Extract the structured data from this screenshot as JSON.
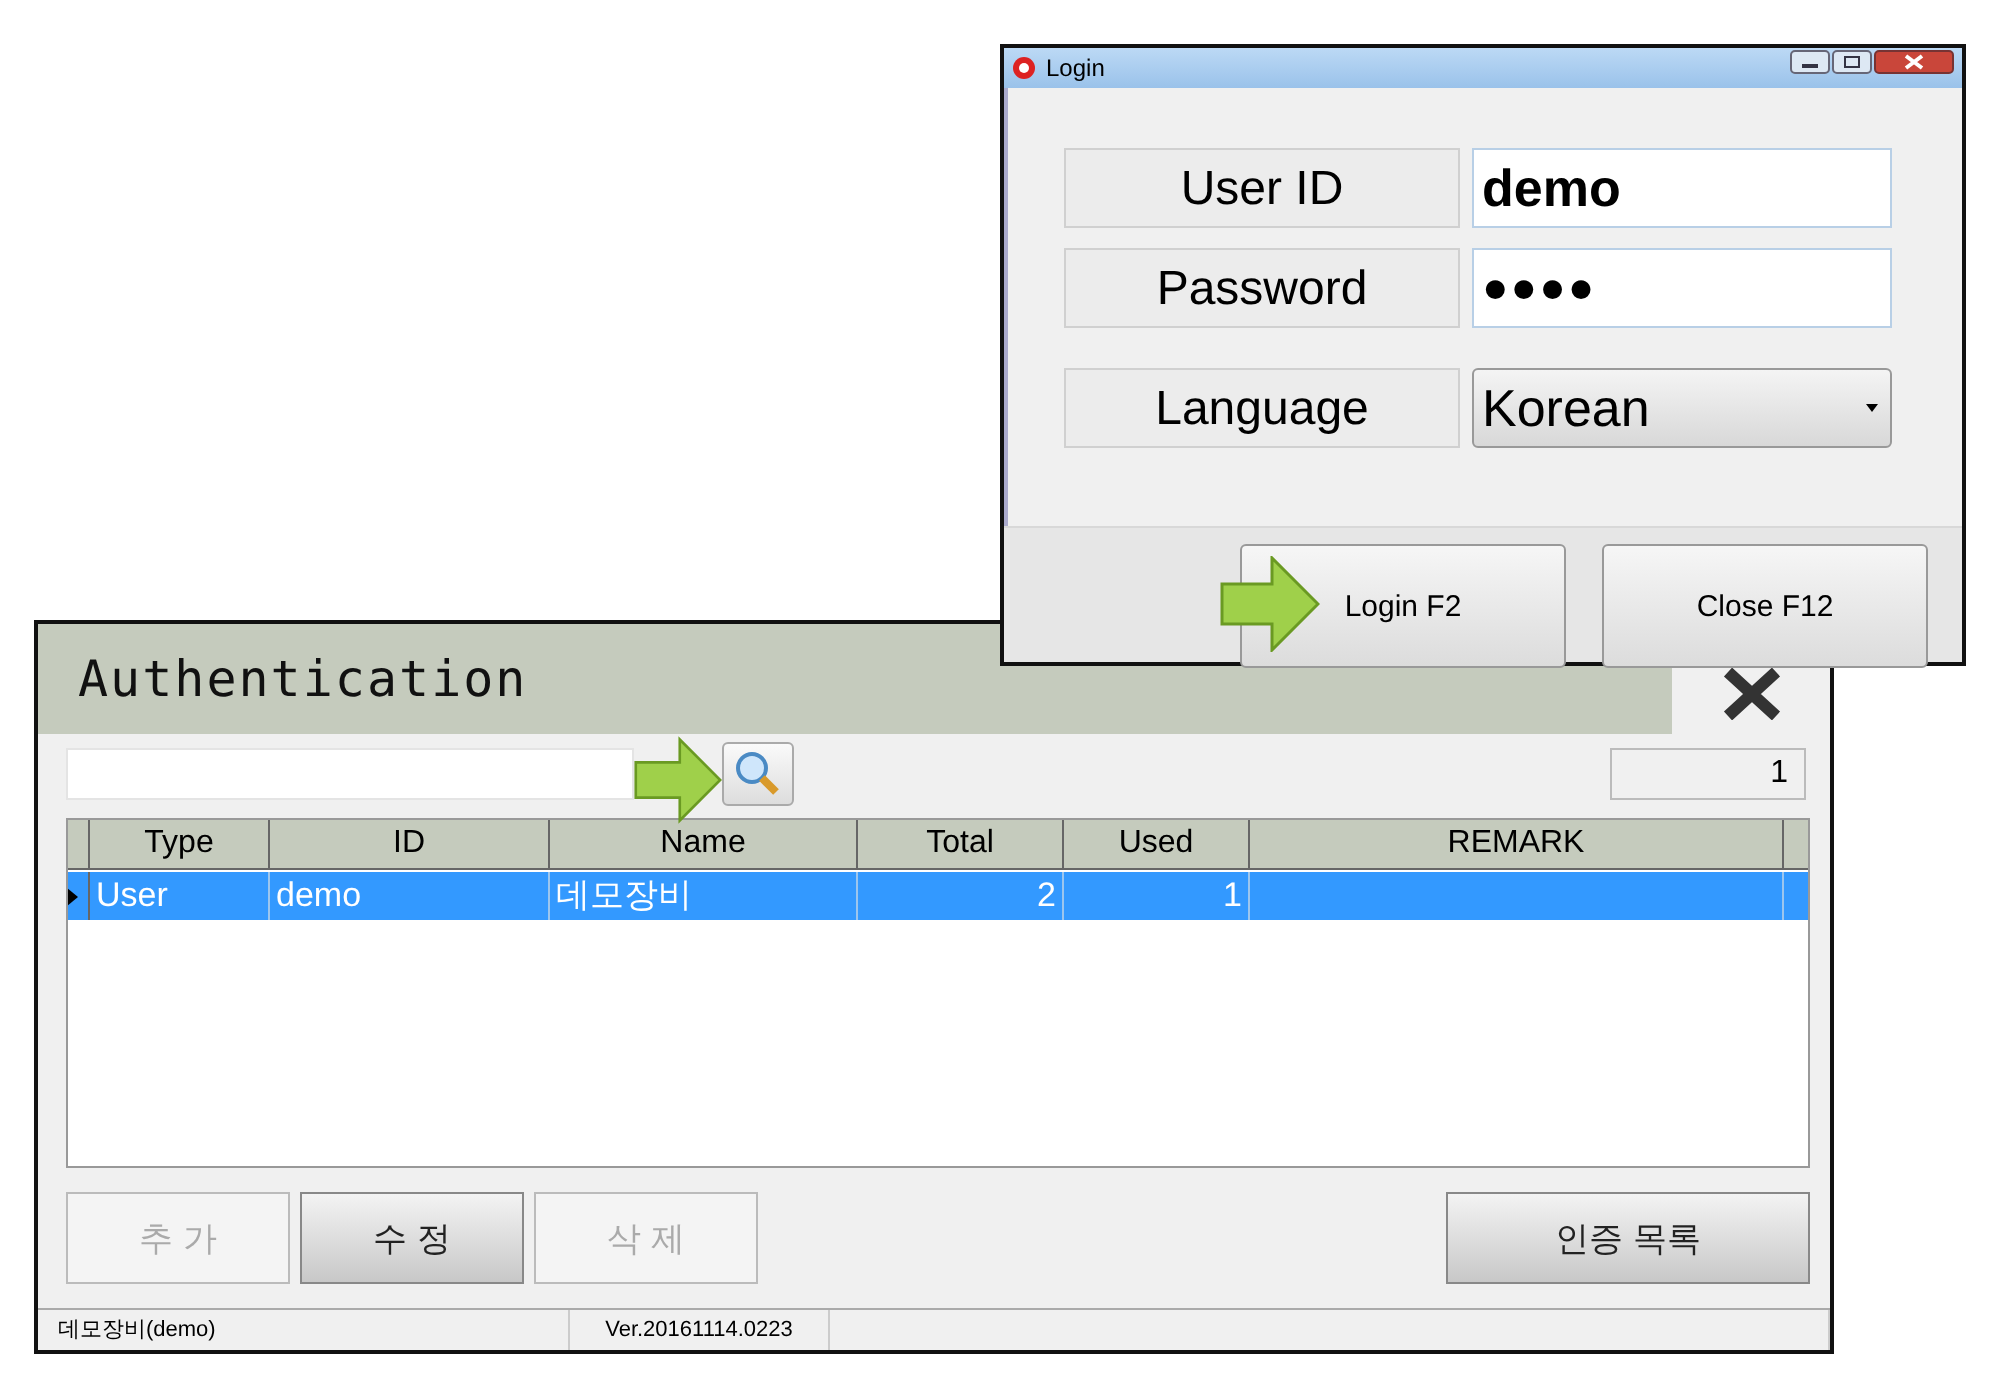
{
  "auth_window": {
    "title": "Authentication",
    "count": "1",
    "table": {
      "columns": [
        "Type",
        "ID",
        "Name",
        "Total",
        "Used",
        "REMARK"
      ],
      "rows": [
        {
          "cells": [
            "User",
            "demo",
            "데모장비",
            "2",
            "1",
            ""
          ],
          "selected": true
        }
      ]
    },
    "buttons": [
      {
        "label": "추 가",
        "disabled": true
      },
      {
        "label": "수 정",
        "disabled": false
      },
      {
        "label": "삭 제",
        "disabled": true
      },
      {
        "label": "인증 목록",
        "disabled": false
      }
    ],
    "status_bar": [
      "데모장비(demo)",
      "Ver.20161114.0223"
    ]
  },
  "login_window": {
    "title": "Login",
    "fields": [
      {
        "label": "User ID",
        "value": "demo",
        "kind": "text"
      },
      {
        "label": "Password",
        "value": "●●●●",
        "kind": "password"
      },
      {
        "label": "Language",
        "value": "Korean",
        "kind": "select"
      }
    ],
    "buttons": [
      "Login F2",
      "Close F12"
    ]
  }
}
